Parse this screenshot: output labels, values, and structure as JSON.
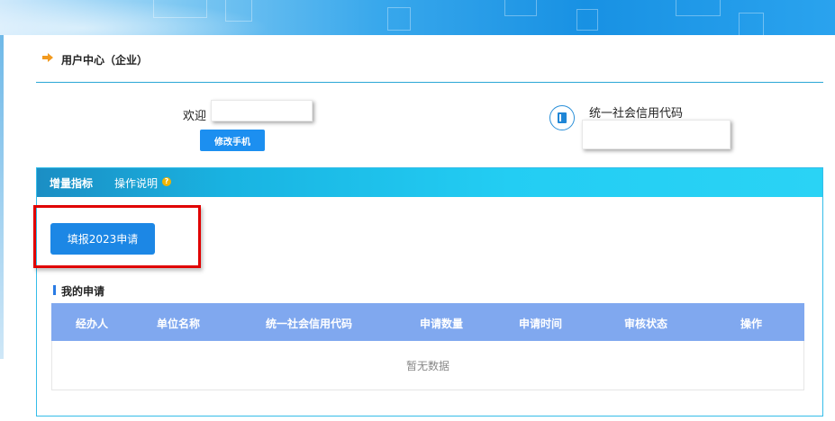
{
  "header": {
    "title": "用户中心（企业）",
    "icon": "arrow-right-icon"
  },
  "welcome": {
    "prefix": "欢迎",
    "change_phone_button": "修改手机"
  },
  "credit": {
    "label": "统一社会信用代码",
    "icon": "book-icon"
  },
  "tabs": [
    {
      "label": "增量指标",
      "active": true
    },
    {
      "label": "操作说明",
      "active": false
    }
  ],
  "apply_button": "填报2023申请",
  "my_applications": {
    "title": "我的申请",
    "columns": [
      "经办人",
      "单位名称",
      "统一社会信用代码",
      "申请数量",
      "申请时间",
      "审核状态",
      "操作"
    ],
    "empty_text": "暂无数据"
  },
  "colors": {
    "accent": "#1c8ff0",
    "table_header": "#80a8ef",
    "panel_border": "#35bde9",
    "highlight": "#e00000"
  }
}
